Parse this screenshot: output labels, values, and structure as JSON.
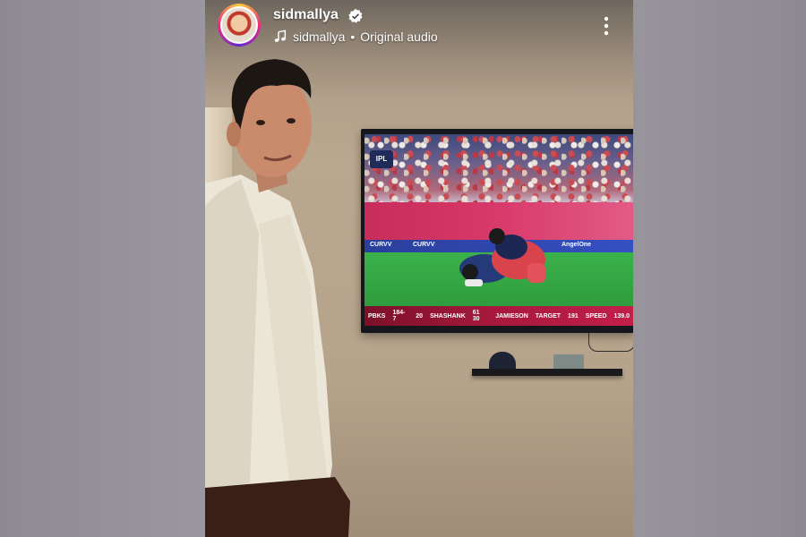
{
  "post": {
    "username": "sidmallya",
    "audio_owner": "sidmallya",
    "audio_separator": "•",
    "audio_title": "Original audio"
  },
  "icons": {
    "avatar": "profile-avatar",
    "verified": "verified-badge-icon",
    "music": "music-note-icon",
    "more": "more-vertical-icon"
  },
  "tv_broadcast": {
    "logo": "IPL",
    "ads": [
      "CURVV",
      "CURVV",
      "AngelOne"
    ],
    "score": {
      "team": "PBKS",
      "runs": "184-7",
      "overs": "20",
      "batter": "SHASHANK",
      "batter_score": "61 30",
      "bowler": "JAMIESON",
      "target_label": "TARGET",
      "target": "191",
      "speed_label": "SPEED",
      "speed": "139.0"
    }
  },
  "colors": {
    "accent_ring": [
      "#f9ce34",
      "#ee2a7b",
      "#6228d7"
    ],
    "verified": "#ffffff"
  }
}
